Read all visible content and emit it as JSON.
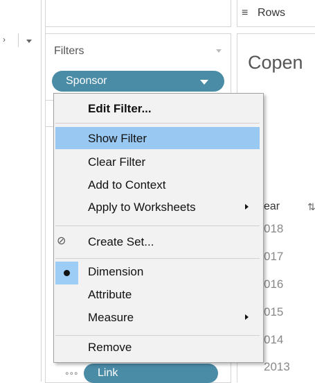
{
  "left_strip": {
    "chevron": "›"
  },
  "filters": {
    "title": "Filters",
    "pill_label": "Sponsor"
  },
  "rows_shelf": {
    "icon": "≡",
    "label": "Rows"
  },
  "view": {
    "title_partial": "Copen",
    "column_header": "ear",
    "years": [
      "018",
      "017",
      "016",
      "015",
      "014",
      "2013"
    ]
  },
  "marks": {
    "pill_label": "Link",
    "pill_icon": "∘∘∘"
  },
  "context_menu": {
    "items": [
      {
        "label": "Edit Filter...",
        "bold": true
      },
      {
        "label": "Show Filter",
        "highlighted": true
      },
      {
        "label": "Clear Filter"
      },
      {
        "label": "Add to Context"
      },
      {
        "label": "Apply to Worksheets",
        "submenu": true
      },
      {
        "label": "Create Set...",
        "icon": "set-icon"
      },
      {
        "label": "Dimension",
        "checked": true
      },
      {
        "label": "Attribute"
      },
      {
        "label": "Measure",
        "submenu": true
      },
      {
        "label": "Remove"
      }
    ]
  },
  "colors": {
    "pill_blue": "#4a8ba6",
    "menu_highlight": "#99c9f3",
    "menu_background": "#f2f2f2"
  }
}
